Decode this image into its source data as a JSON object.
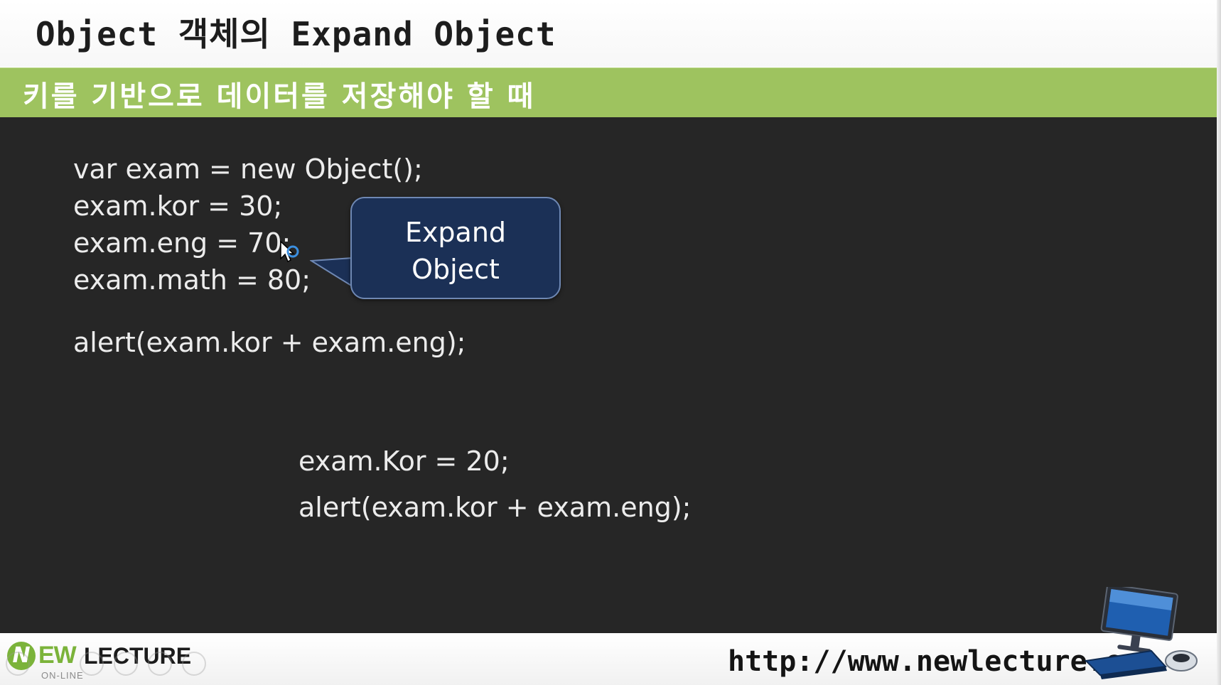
{
  "slide": {
    "title": "Object 객체의 Expand Object",
    "subtitle": "키를 기반으로 데이터를 저장해야 할 때",
    "code_block_1": [
      "var exam = new Object();",
      "exam.kor = 30;",
      "exam.eng = 70;",
      "exam.math = 80;"
    ],
    "code_alert_1": "alert(exam.kor + exam.eng);",
    "code_block_2": [
      "exam.Kor = 20;",
      "alert(exam.kor + exam.eng);"
    ],
    "callout": {
      "line1": "Expand",
      "line2": "Object"
    }
  },
  "footer": {
    "logo_n": "N",
    "logo_ew": "EW",
    "logo_lecture": "LECTURE",
    "logo_sub": "ON-LINE",
    "url": "http://www.newlecture.com"
  },
  "colors": {
    "subtitle_bar": "#9ec35f",
    "code_background": "#262626",
    "callout_fill": "#1b3056",
    "callout_border": "#6f88b3",
    "logo_green": "#7bb33a"
  },
  "icons": {
    "cursor": "arrow-cursor-icon",
    "computer": "computer-illustration-icon"
  }
}
